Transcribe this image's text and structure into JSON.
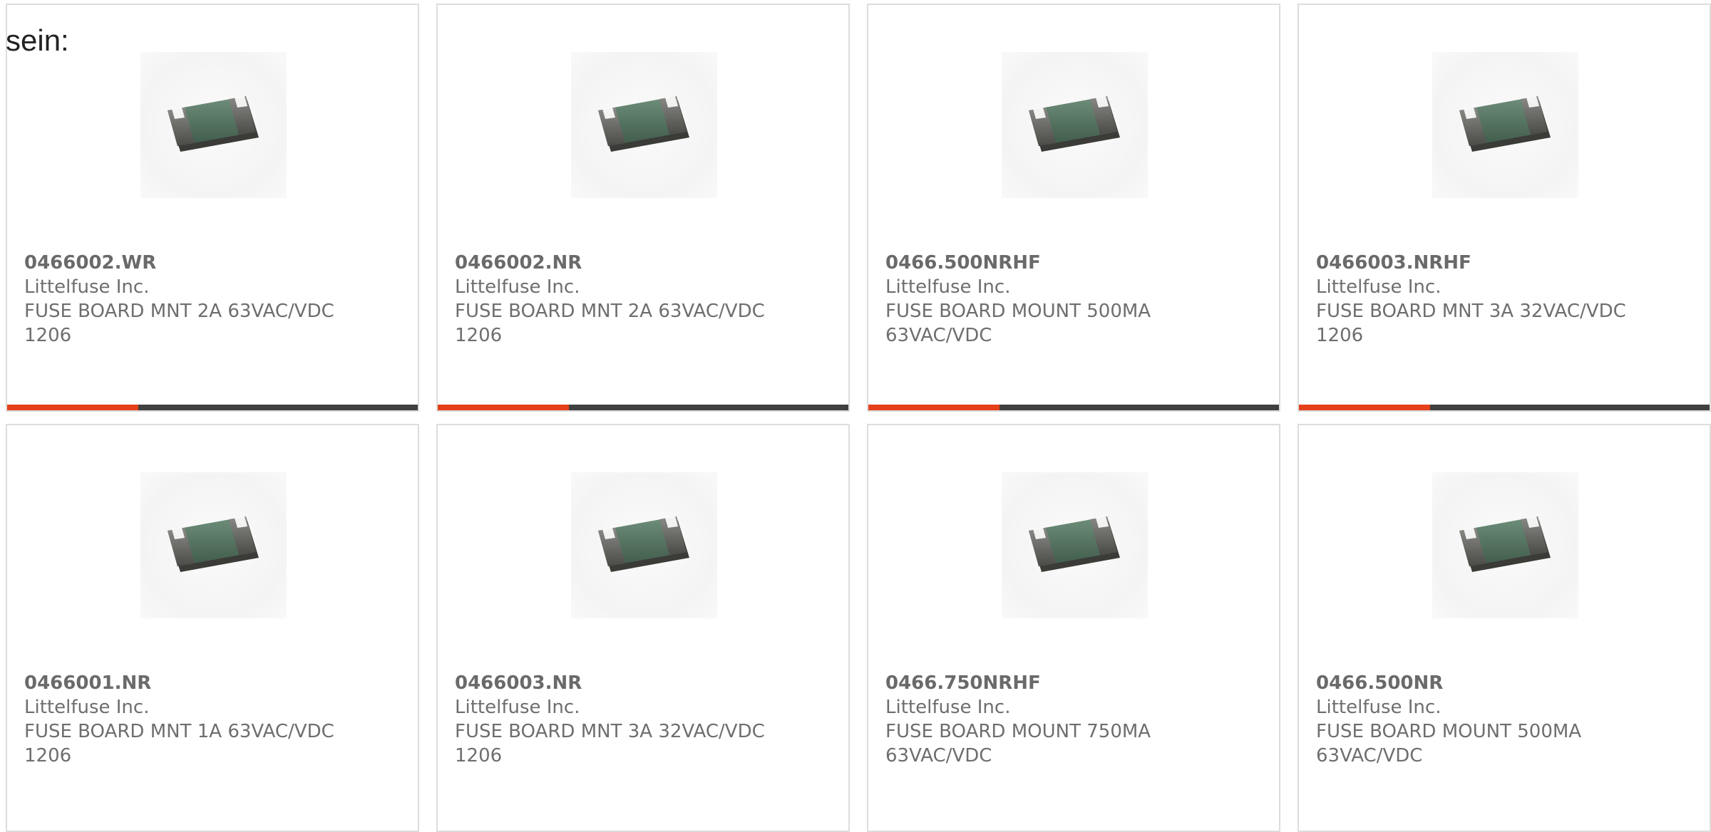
{
  "intro_text": "sein:",
  "colors": {
    "accent": "#e4401a",
    "bar_track": "#404040"
  },
  "progress_fraction": 0.32,
  "products": [
    {
      "part_number": "0466002.WR",
      "manufacturer": "Littelfuse Inc.",
      "desc_line1": "FUSE BOARD MNT 2A 63VAC/VDC",
      "desc_line2": "1206",
      "image_icon": "smd-fuse-icon"
    },
    {
      "part_number": "0466002.NR",
      "manufacturer": "Littelfuse Inc.",
      "desc_line1": "FUSE BOARD MNT 2A 63VAC/VDC",
      "desc_line2": "1206",
      "image_icon": "smd-fuse-icon"
    },
    {
      "part_number": "0466.500NRHF",
      "manufacturer": "Littelfuse Inc.",
      "desc_line1": "FUSE BOARD MOUNT 500MA",
      "desc_line2": "63VAC/VDC",
      "image_icon": "smd-fuse-icon"
    },
    {
      "part_number": "0466003.NRHF",
      "manufacturer": "Littelfuse Inc.",
      "desc_line1": "FUSE BOARD MNT 3A 32VAC/VDC",
      "desc_line2": "1206",
      "image_icon": "smd-fuse-icon"
    },
    {
      "part_number": "0466001.NR",
      "manufacturer": "Littelfuse Inc.",
      "desc_line1": "FUSE BOARD MNT 1A 63VAC/VDC",
      "desc_line2": "1206",
      "image_icon": "smd-fuse-icon"
    },
    {
      "part_number": "0466003.NR",
      "manufacturer": "Littelfuse Inc.",
      "desc_line1": "FUSE BOARD MNT 3A 32VAC/VDC",
      "desc_line2": "1206",
      "image_icon": "smd-fuse-icon"
    },
    {
      "part_number": "0466.750NRHF",
      "manufacturer": "Littelfuse Inc.",
      "desc_line1": "FUSE BOARD MOUNT 750MA",
      "desc_line2": "63VAC/VDC",
      "image_icon": "smd-fuse-icon"
    },
    {
      "part_number": "0466.500NR",
      "manufacturer": "Littelfuse Inc.",
      "desc_line1": "FUSE BOARD MOUNT 500MA",
      "desc_line2": "63VAC/VDC",
      "image_icon": "smd-fuse-icon"
    }
  ]
}
